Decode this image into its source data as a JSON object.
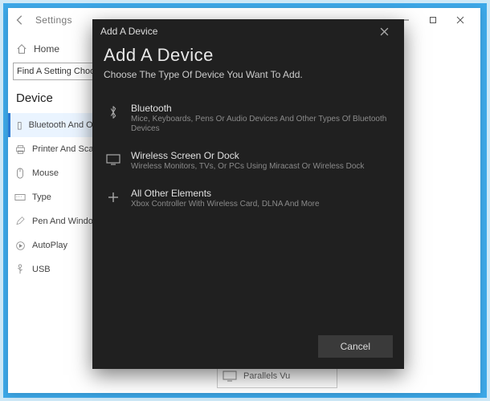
{
  "settingsWindow": {
    "title": "Settings",
    "home": "Home",
    "searchPlaceholder": "Find A Setting Choose The Type Of Device You Want To Add.",
    "sectionLabel": "Device",
    "nav": {
      "bluetooth": "Bluetooth And Others d",
      "printers": "Printer And Scanner",
      "mouse": "Mouse",
      "typing": "Type",
      "pen": "Pen And Windows",
      "autoplay": "AutoPlay",
      "usb": "USB"
    },
    "tile": "Parallels Vu"
  },
  "modal": {
    "header": "Add A Device",
    "title": "Add A Device",
    "subtitle": "Choose The Type Of Device You Want To Add.",
    "options": {
      "bluetooth": {
        "title": "Bluetooth",
        "desc": "Mice, Keyboards, Pens Or Audio Devices And Other Types Of Bluetooth Devices"
      },
      "wireless": {
        "title": "Wireless Screen Or Dock",
        "desc": "Wireless Monitors, TVs, Or PCs Using Miracast Or Wireless Dock"
      },
      "other": {
        "title": "All Other Elements",
        "desc": "Xbox Controller With Wireless Card, DLNA And More"
      }
    },
    "cancel": "Cancel"
  }
}
